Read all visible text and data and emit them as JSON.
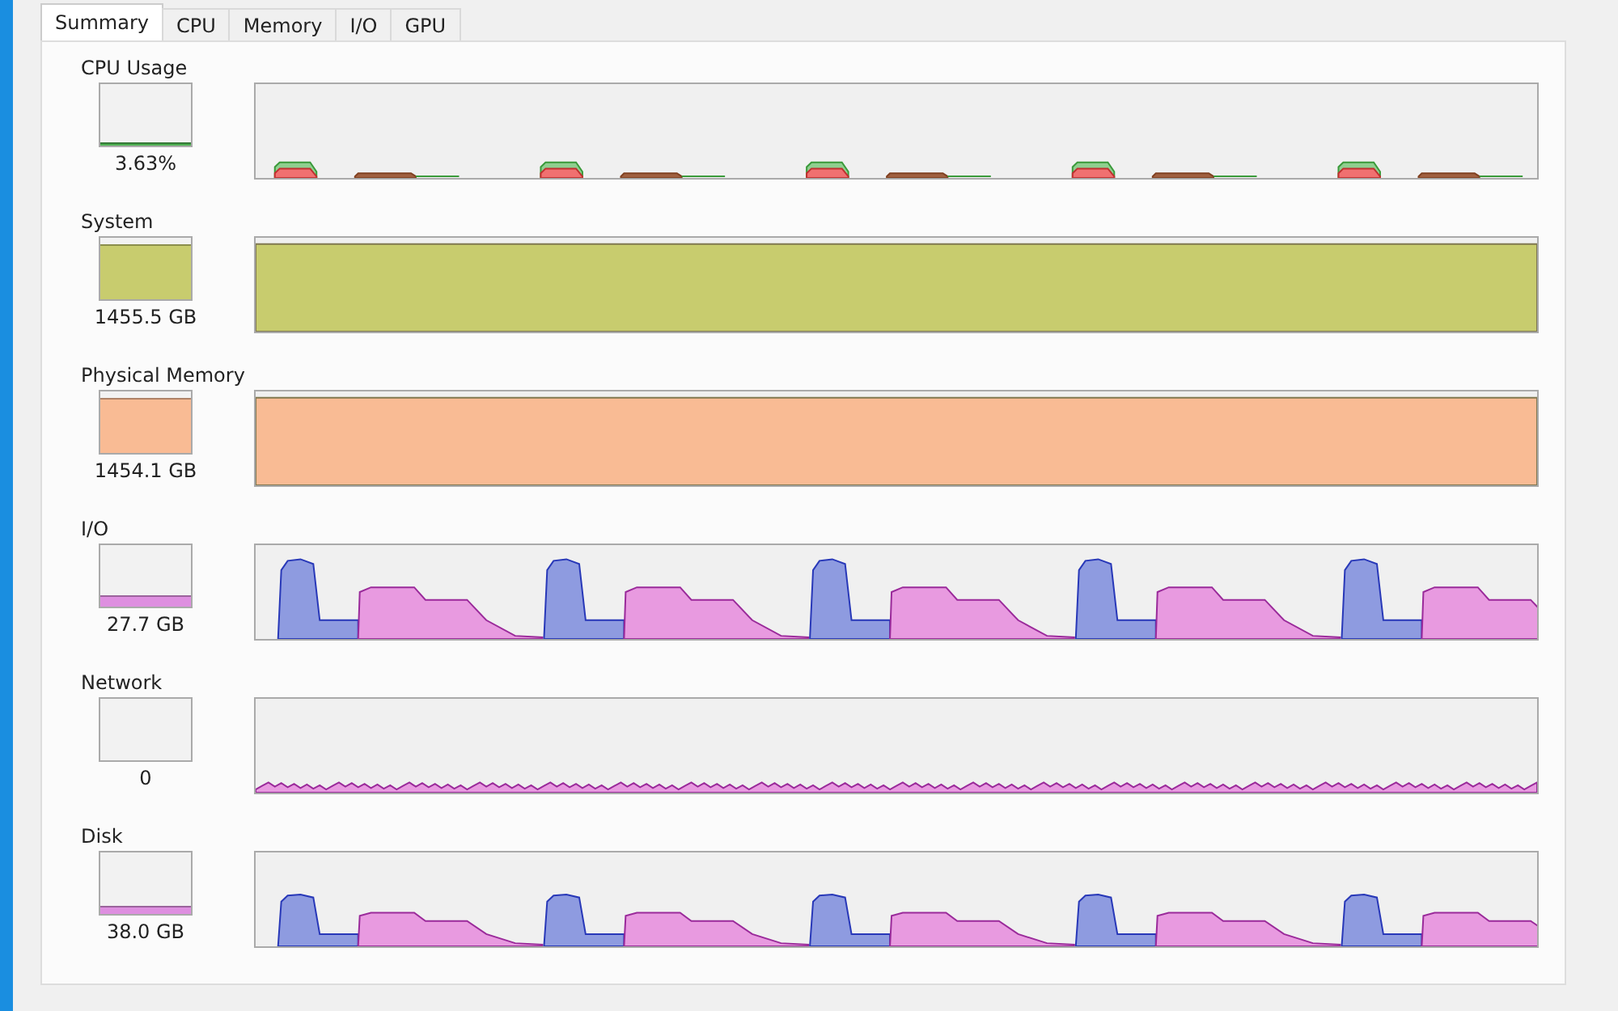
{
  "tabs": [
    {
      "label": "Summary",
      "selected": true
    },
    {
      "label": "CPU",
      "selected": false
    },
    {
      "label": "Memory",
      "selected": false
    },
    {
      "label": "I/O",
      "selected": false
    },
    {
      "label": "GPU",
      "selected": false
    }
  ],
  "sections": [
    {
      "title": "CPU Usage",
      "kind": "cpu",
      "reading": "3.63%"
    },
    {
      "title": "System",
      "kind": "fill",
      "reading": "1455.5 GB",
      "color": "#c8cc6e"
    },
    {
      "title": "Physical Memory",
      "kind": "fill",
      "reading": "1454.1 GB",
      "color": "#f9bb94"
    },
    {
      "title": "I/O",
      "kind": "io",
      "reading": "27.7 GB"
    },
    {
      "title": "Network",
      "kind": "network",
      "reading": "0"
    },
    {
      "title": "Disk",
      "kind": "disk",
      "reading": "38.0 GB"
    }
  ]
}
